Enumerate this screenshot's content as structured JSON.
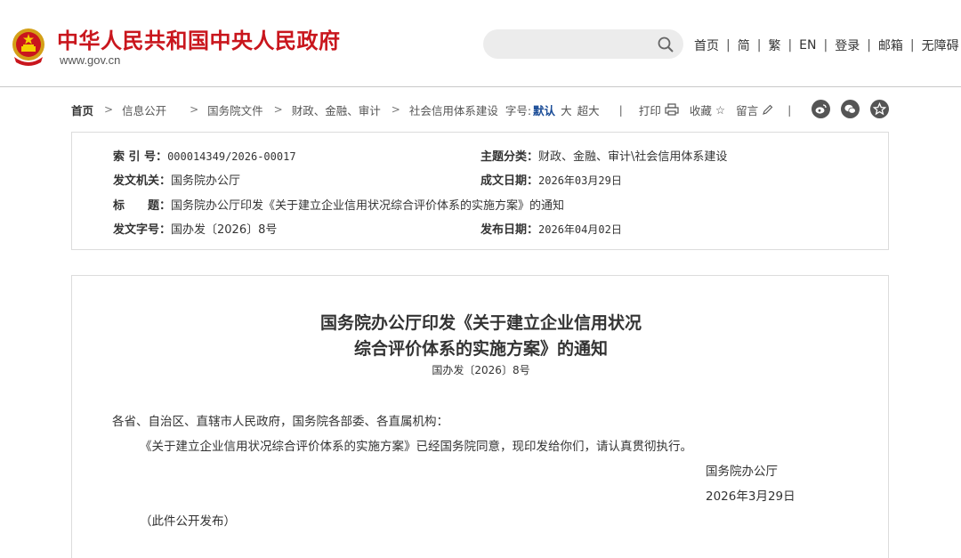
{
  "header": {
    "site_name": "中华人民共和国中央人民政府",
    "site_url": "www.gov.cn",
    "search": {
      "placeholder": ""
    },
    "nav": [
      "首页",
      "简",
      "繁",
      "EN",
      "登录",
      "邮箱",
      "无障碍"
    ],
    "emblem_icon": "national-emblem-icon",
    "colors": {
      "brand_red": "#c9161d",
      "link_blue": "#1a4c97"
    }
  },
  "breadcrumb": {
    "items": [
      "首页",
      "信息公开",
      "国务院文件",
      "财政、金融、审计",
      "社会信用体系建设"
    ],
    "font_size_label": "字号:",
    "font_size_default": "默认",
    "font_size_large": "大",
    "font_size_xlarge": "超大",
    "separator": "|",
    "print_label": "打印",
    "favorite_label": "收藏",
    "comment_label": "留言",
    "social_icons": [
      "weibo-icon",
      "wechat-icon",
      "favorite-star-icon"
    ]
  },
  "meta": {
    "index_no_label": "索 引 号：",
    "index_no": "000014349/2026-00017",
    "category_label": "主题分类：",
    "category": "财政、金融、审计\\社会信用体系建设",
    "issuer_label": "发文机关：",
    "issuer": "国务院办公厅",
    "written_date_label": "成文日期：",
    "written_date": "2026年03月29日",
    "title_label": "标　　题：",
    "title": "国务院办公厅印发《关于建立企业信用状况综合评价体系的实施方案》的通知",
    "doc_no_label": "发文字号：",
    "doc_no": "国办发〔2026〕8号",
    "publish_date_label": "发布日期：",
    "publish_date": "2026年04月02日"
  },
  "article": {
    "title_line1": "国务院办公厅印发《关于建立企业信用状况",
    "title_line2": "综合评价体系的实施方案》的通知",
    "doc_no": "国办发〔2026〕8号",
    "salutation": "各省、自治区、直辖市人民政府，国务院各部委、各直属机构：",
    "body": "《关于建立企业信用状况综合评价体系的实施方案》已经国务院同意，现印发给你们，请认真贯彻执行。",
    "signature": "国务院办公厅",
    "date": "2026年3月29日",
    "note": "（此件公开发布）"
  }
}
